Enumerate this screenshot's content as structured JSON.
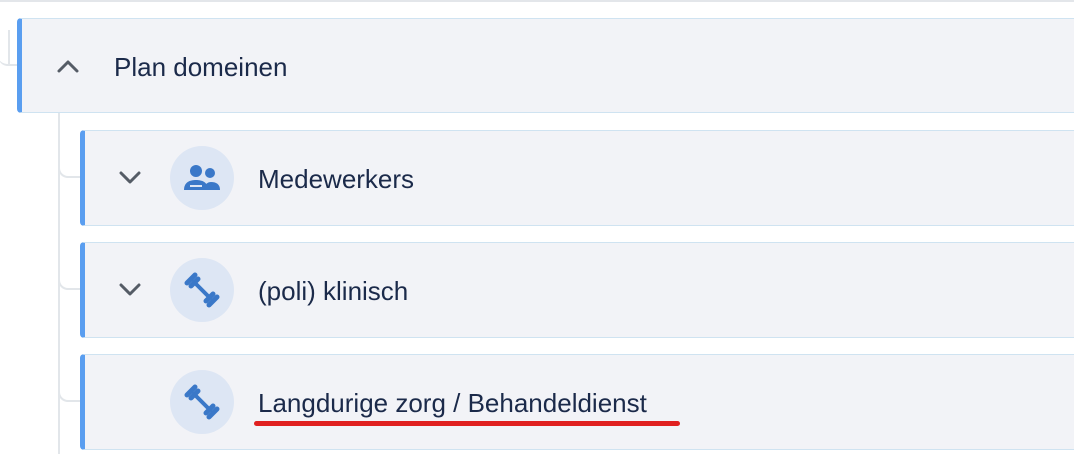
{
  "tree": {
    "root": {
      "label": "Plan domeinen",
      "expanded": true,
      "chevron_icon": "chevron-up-icon"
    },
    "children": [
      {
        "label": "Medewerkers",
        "icon": "users-icon",
        "chevron_icon": "chevron-down-icon"
      },
      {
        "label": "(poli) klinisch",
        "icon": "dumbbell-icon",
        "chevron_icon": "chevron-down-icon"
      },
      {
        "label": "Langdurige zorg / Behandeldienst",
        "icon": "dumbbell-icon",
        "highlighted": true
      }
    ]
  },
  "colors": {
    "accent": "#5a9ef0",
    "icon": "#3a78c8",
    "icon_bg": "#dde6f4",
    "row_bg": "#f2f3f7",
    "text": "#1b2a4a",
    "highlight": "#e02020"
  }
}
